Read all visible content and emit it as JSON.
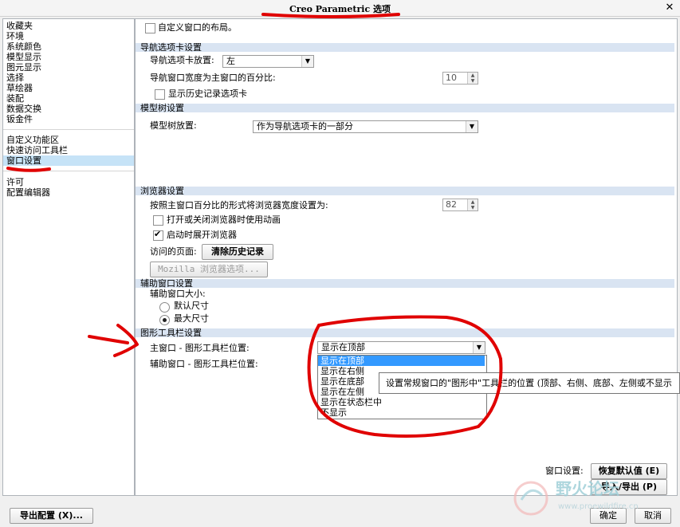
{
  "window": {
    "title": "Creo Parametric 选项",
    "close_icon": "✕"
  },
  "sidebar": {
    "group1": [
      "收藏夹",
      "环境",
      "系统颜色",
      "模型显示",
      "图元显示",
      "选择",
      "草绘器",
      "装配",
      "数据交换",
      "钣金件"
    ],
    "group2": [
      "自定义功能区",
      "快速访问工具栏",
      "窗口设置"
    ],
    "group3": [
      "许可",
      "配置编辑器"
    ],
    "selected": "窗口设置"
  },
  "main": {
    "custom_layout_label": "自定义窗口的布局。",
    "nav_section": {
      "title": "导航选项卡设置",
      "placement_label": "导航选项卡放置:",
      "placement_value": "左",
      "width_label": "导航窗口宽度为主窗口的百分比:",
      "width_value": "10",
      "show_history_label": "显示历史记录选项卡"
    },
    "model_tree_section": {
      "title": "模型树设置",
      "placement_label": "模型树放置:",
      "placement_value": "作为导航选项卡的一部分"
    },
    "browser_section": {
      "title": "浏览器设置",
      "width_label": "按照主窗口百分比的形式将浏览器宽度设置为:",
      "width_value": "82",
      "animation_label": "打开或关闭浏览器时使用动画",
      "expand_label": "启动时展开浏览器",
      "expand_checked": true,
      "visited_label": "访问的页面:",
      "clear_history_button": "清除历史记录",
      "mozilla_button": "Mozilla 浏览器选项..."
    },
    "aux_section": {
      "title": "辅助窗口设置",
      "size_label": "辅助窗口大小:",
      "default_size": "默认尺寸",
      "max_size": "最大尺寸",
      "selected": "最大尺寸"
    },
    "graphics_toolbar_section": {
      "title": "图形工具栏设置",
      "main_label": "主窗口 - 图形工具栏位置:",
      "main_value": "显示在顶部",
      "aux_label": "辅助窗口 - 图形工具栏位置:",
      "options": [
        "显示在顶部",
        "显示在右侧",
        "显示在底部",
        "显示在左侧",
        "显示在状态栏中",
        "不显示"
      ],
      "highlighted_option": "显示在顶部"
    },
    "tooltip": "设置常规窗口的\"图形中\"工具栏的位置 (顶部、右侧、底部、左侧或不显示"
  },
  "footer": {
    "window_settings_label": "窗口设置:",
    "restore_defaults_button": "恢复默认值 (E)",
    "import_export_button": "导入/导出 (P)",
    "export_config_button": "导出配置 (X)...",
    "ok_button": "确定",
    "cancel_button": "取消"
  },
  "watermark": {
    "text": "野火论坛",
    "url": "www.proewildfire.cn"
  }
}
